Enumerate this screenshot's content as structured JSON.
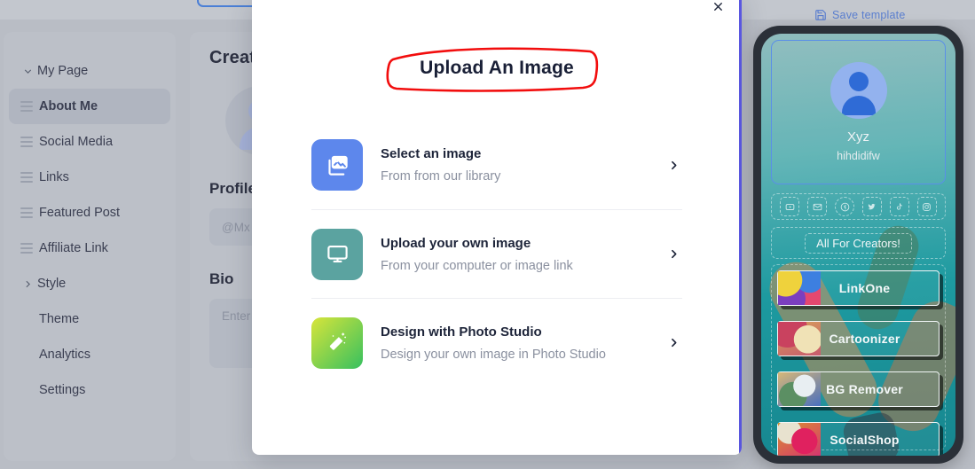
{
  "topbar": {
    "save_template_label": "Save template",
    "save_icon": "floppy-disk-icon"
  },
  "sidebar": {
    "items": [
      {
        "label": "My Page",
        "icon": "chevron-down-icon",
        "active": false
      },
      {
        "label": "About Me",
        "icon": "drag-handle-icon",
        "active": true
      },
      {
        "label": "Social Media",
        "icon": "drag-handle-icon",
        "active": false
      },
      {
        "label": "Links",
        "icon": "drag-handle-icon",
        "active": false
      },
      {
        "label": "Featured Post",
        "icon": "drag-handle-icon",
        "active": false
      },
      {
        "label": "Affiliate Link",
        "icon": "drag-handle-icon",
        "active": false
      },
      {
        "label": "Style",
        "icon": "chevron-right-icon",
        "active": false
      },
      {
        "label": "Theme",
        "icon": "none",
        "active": false
      },
      {
        "label": "Analytics",
        "icon": "none",
        "active": false
      },
      {
        "label": "Settings",
        "icon": "none",
        "active": false
      }
    ]
  },
  "editor": {
    "heading": "Create your page",
    "profile_label": "Profile",
    "profile_value": "@Mx",
    "bio_label": "Bio",
    "bio_placeholder": "Enter your bio"
  },
  "modal": {
    "title": "Upload An Image",
    "close_icon": "close-icon",
    "annotation": {
      "shape": "hand-drawn-rectangle",
      "color": "#f20d0d"
    },
    "accent_color": "#5a57e0",
    "options": [
      {
        "title": "Select an image",
        "subtitle": "From from our library",
        "icon": "image-library-icon",
        "icon_color": "#5d87ec",
        "chevron": "chevron-right-icon"
      },
      {
        "title": "Upload your own image",
        "subtitle": "From your computer or image link",
        "icon": "desktop-monitor-icon",
        "icon_color": "#5ba3a0",
        "chevron": "chevron-right-icon"
      },
      {
        "title": "Design with Photo Studio",
        "subtitle": "Design your own image in Photo Studio",
        "icon": "magic-wand-icon",
        "icon_color": "#36c05f",
        "chevron": "chevron-right-icon"
      }
    ]
  },
  "preview": {
    "profile": {
      "avatar_icon": "user-avatar-icon",
      "name": "Xyz",
      "handle": "hihdidifw"
    },
    "social_icons": [
      "youtube-icon",
      "email-icon",
      "facebook-icon",
      "twitter-icon",
      "tiktok-icon",
      "instagram-icon"
    ],
    "headline": "All For Creators!",
    "links": [
      {
        "label": "LinkOne"
      },
      {
        "label": "Cartoonizer"
      },
      {
        "label": "BG Remover"
      },
      {
        "label": "SocialShop"
      }
    ]
  }
}
